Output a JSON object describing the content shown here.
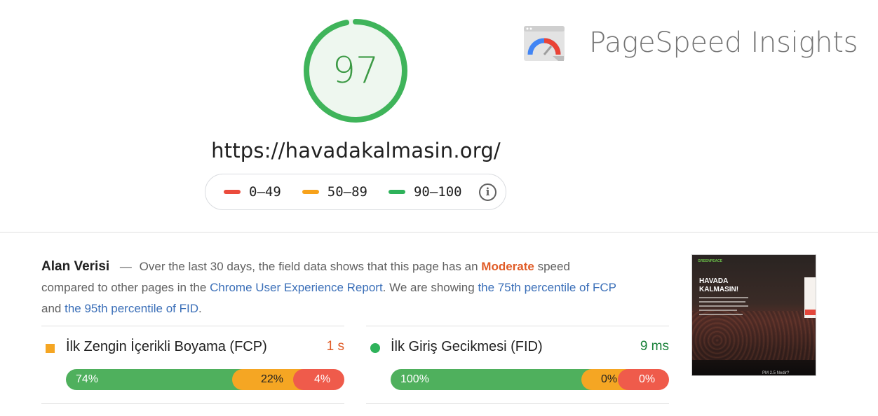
{
  "score": {
    "value": "97",
    "fraction": 0.97,
    "color": "#3c9a45"
  },
  "url": "https://havadakalmasin.org/",
  "legend": {
    "items": [
      {
        "label": "0–49",
        "color": "#eb4b3c"
      },
      {
        "label": "50–89",
        "color": "#f7a21b"
      },
      {
        "label": "90–100",
        "color": "#2eb25a"
      }
    ],
    "info_icon": "info-icon"
  },
  "brand": {
    "title": "PageSpeed Insights",
    "logo_icon": "pagespeed-gauge-icon"
  },
  "field_data": {
    "title": "Alan Verisi",
    "dash": "—",
    "text1": "Over the last 30 days, the field data shows that this page has an",
    "moderate": "Moderate",
    "text2": "speed compared to other pages in the",
    "link1": "Chrome User Experience Report",
    "text3": ". We are showing",
    "link2": "the 75th percentile of FCP",
    "text4": "and",
    "link3": "the 95th percentile of FID",
    "text5": "."
  },
  "metrics": [
    {
      "name": "İlk Zengin İçerikli Boyama (FCP)",
      "value": "1 s",
      "value_color": "#e05b26",
      "indicator": "orange-square-icon",
      "distribution": [
        {
          "label": "74%",
          "fraction": 0.74
        },
        {
          "label": "22%",
          "fraction": 0.22
        },
        {
          "label": "4%",
          "fraction": 0.04
        }
      ]
    },
    {
      "name": "İlk Giriş Gecikmesi (FID)",
      "value": "9 ms",
      "value_color": "#188038",
      "indicator": "green-circle-icon",
      "distribution": [
        {
          "label": "100%",
          "fraction": 1.0
        },
        {
          "label": "0%",
          "fraction": 0.0
        },
        {
          "label": "0%",
          "fraction": 0.0
        }
      ]
    }
  ],
  "thumbnail": {
    "logo_text": "GREENPEACE",
    "heading": "HAVADA KALMASIN!",
    "bottom_text": "PM 2.5 Nedir?"
  }
}
